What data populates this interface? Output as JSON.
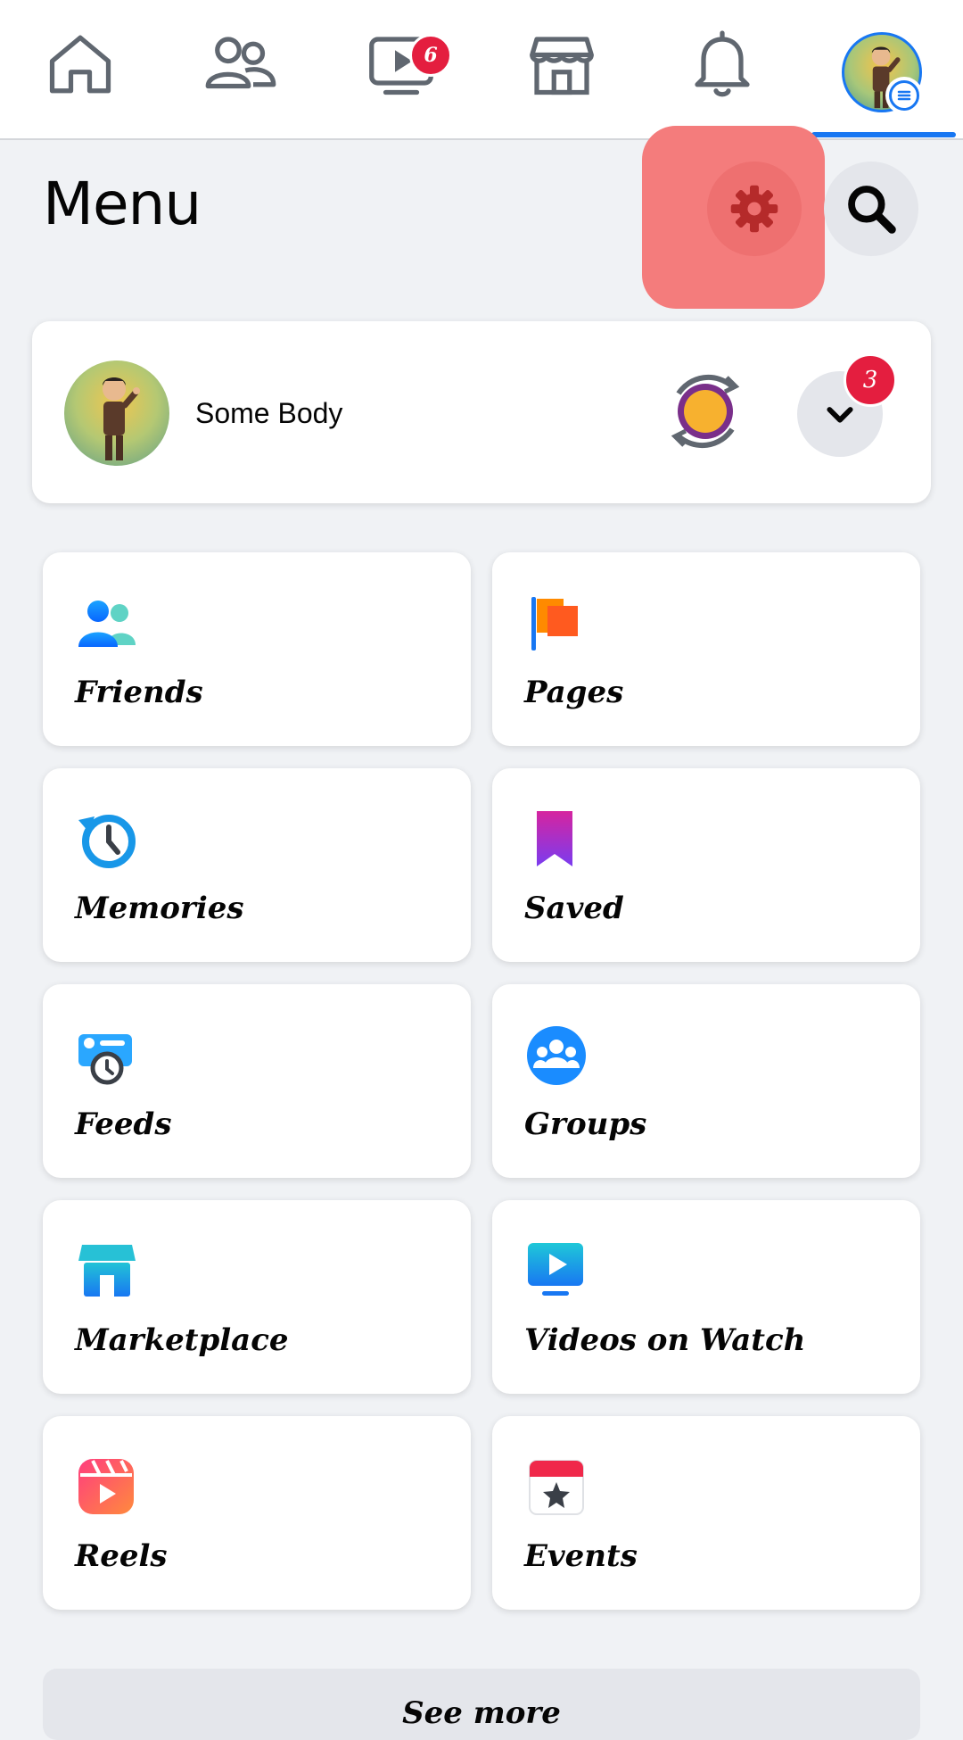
{
  "nav": {
    "items": [
      {
        "name": "home"
      },
      {
        "name": "friends"
      },
      {
        "name": "watch",
        "badge": "6"
      },
      {
        "name": "marketplace"
      },
      {
        "name": "notifications"
      },
      {
        "name": "menu"
      }
    ]
  },
  "header": {
    "title": "Menu"
  },
  "profile": {
    "name": "Some Body",
    "badge_count": "3"
  },
  "shortcuts": [
    {
      "label": "Friends",
      "icon": "friends-icon"
    },
    {
      "label": "Pages",
      "icon": "flag-icon"
    },
    {
      "label": "Memories",
      "icon": "memories-clock-icon"
    },
    {
      "label": "Saved",
      "icon": "bookmark-icon"
    },
    {
      "label": "Feeds",
      "icon": "feeds-icon"
    },
    {
      "label": "Groups",
      "icon": "groups-icon"
    },
    {
      "label": "Marketplace",
      "icon": "store-icon"
    },
    {
      "label": "Videos on Watch",
      "icon": "video-icon"
    },
    {
      "label": "Reels",
      "icon": "reels-icon"
    },
    {
      "label": "Events",
      "icon": "calendar-star-icon"
    }
  ],
  "see_more": "See more",
  "colors": {
    "accent": "#1877f2",
    "badge": "#e41e3f",
    "highlight": "#f47c7c"
  }
}
